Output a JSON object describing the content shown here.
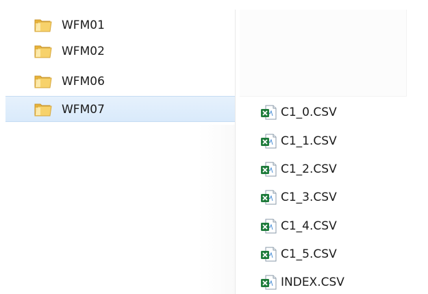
{
  "folders": {
    "items": [
      {
        "name": "WFM01",
        "selected": false,
        "icon": "folder-icon"
      },
      {
        "name": "WFM02",
        "selected": false,
        "icon": "folder-icon"
      },
      {
        "name": "WFM06",
        "selected": false,
        "icon": "folder-icon"
      },
      {
        "name": "WFM07",
        "selected": true,
        "icon": "folder-icon"
      }
    ]
  },
  "files": {
    "items": [
      {
        "name": "C1_0.CSV",
        "icon": "excel-csv-file-icon"
      },
      {
        "name": "C1_1.CSV",
        "icon": "excel-csv-file-icon"
      },
      {
        "name": "C1_2.CSV",
        "icon": "excel-csv-file-icon"
      },
      {
        "name": "C1_3.CSV",
        "icon": "excel-csv-file-icon"
      },
      {
        "name": "C1_4.CSV",
        "icon": "excel-csv-file-icon"
      },
      {
        "name": "C1_5.CSV",
        "icon": "excel-csv-file-icon"
      },
      {
        "name": "INDEX.CSV",
        "icon": "excel-csv-file-icon"
      }
    ]
  },
  "colors": {
    "selection_background": "#d9eafb",
    "selection_border": "#c5dcf3",
    "folder_yellow": "#f2c34b",
    "excel_green": "#1e7b3b"
  }
}
